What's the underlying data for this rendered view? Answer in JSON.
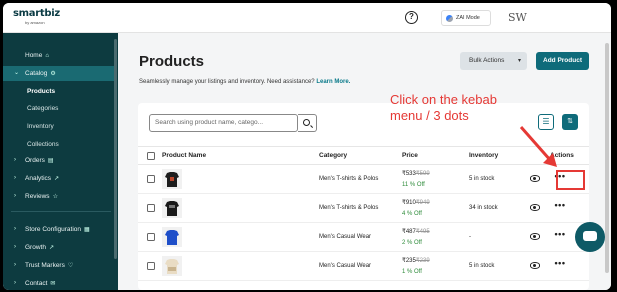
{
  "topbar": {
    "logo": "smartbiz",
    "logo_sub": "by amazon",
    "help": "?",
    "zai_mode": "ZAI Mode",
    "brand_mark": "SW"
  },
  "sidebar": {
    "items": [
      {
        "label": "Home",
        "icon": "home-icon"
      },
      {
        "label": "Catalog",
        "icon": "gear-icon",
        "expanded": true
      },
      {
        "label": "Products",
        "active": true
      },
      {
        "label": "Categories"
      },
      {
        "label": "Inventory"
      },
      {
        "label": "Collections"
      },
      {
        "label": "Orders",
        "icon": "clipboard-icon"
      },
      {
        "label": "Analytics",
        "icon": "trend-icon"
      },
      {
        "label": "Reviews",
        "icon": "star-icon"
      },
      {
        "label": "Store Configuration",
        "icon": "store-icon"
      },
      {
        "label": "Growth",
        "icon": "growth-icon"
      },
      {
        "label": "Trust Markers",
        "icon": "shield-icon"
      },
      {
        "label": "Contact",
        "icon": "contact-icon"
      }
    ]
  },
  "main": {
    "title": "Products",
    "subtitle": "Seamlessly manage your listings and inventory. Need assistance?",
    "learn_more": "Learn More.",
    "bulk_actions": "Bulk Actions",
    "add_product": "Add Product",
    "search_placeholder": "Search using product name, catego..."
  },
  "table": {
    "headers": [
      "Product Name",
      "Category",
      "Price",
      "Inventory",
      "Actions"
    ],
    "rows": [
      {
        "category": "Men's T-shirts & Polos",
        "price": "₹533",
        "old_price": "₹599",
        "off": "11 % Off",
        "inventory": "5 in stock"
      },
      {
        "category": "Men's T-shirts & Polos",
        "price": "₹910",
        "old_price": "₹949",
        "off": "4 % Off",
        "inventory": "34 in stock"
      },
      {
        "category": "Men's Casual Wear",
        "price": "₹487",
        "old_price": "₹495",
        "off": "2 % Off",
        "inventory": "-"
      },
      {
        "category": "Men's Casual Wear",
        "price": "₹235",
        "old_price": "₹239",
        "off": "1 % Off",
        "inventory": "5 in stock"
      }
    ]
  },
  "annotation": {
    "line1": "Click on the kebab",
    "line2": "menu / 3 dots"
  },
  "colors": {
    "sidebar_bg": "#0d3b40",
    "accent": "#0e6b7a",
    "annotation": "#e53935",
    "discount": "#2e8b3a"
  }
}
